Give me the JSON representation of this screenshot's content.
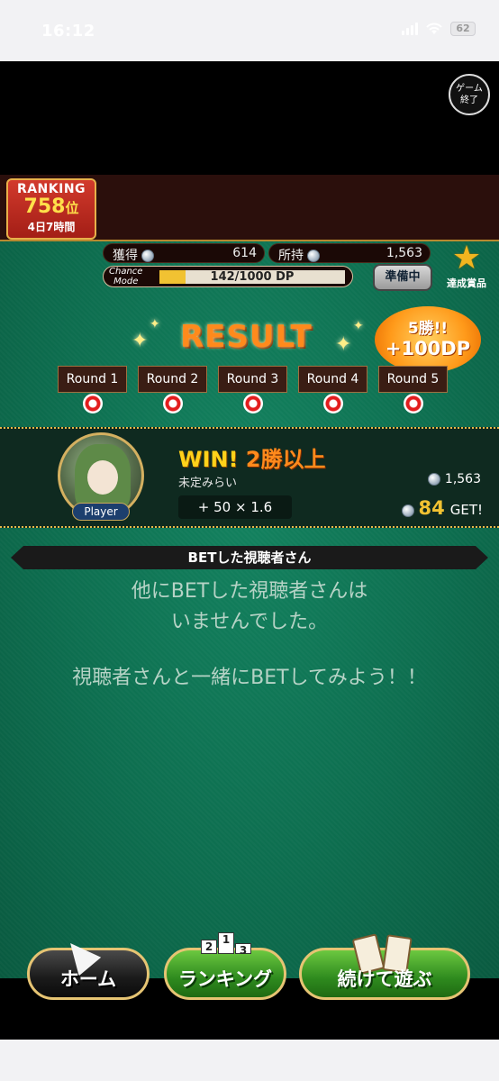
{
  "status_bar": {
    "time": "16:12",
    "battery": "62"
  },
  "game": {
    "exit_button": {
      "line1": "ゲーム",
      "line2": "終了"
    },
    "ranking": {
      "title": "RANKING",
      "position": "758",
      "position_unit": "位",
      "time_left": "4日7時間"
    },
    "stats": {
      "earned_label": "獲得",
      "earned_value": "614",
      "owned_label": "所持",
      "owned_value": "1,563"
    },
    "chance_mode": {
      "label_line1": "Chance",
      "label_line2": "Mode",
      "progress_text": "142/1000 DP",
      "progress_fraction": 0.142
    },
    "prep_button": "準備中",
    "achievement_button": "達成賞品",
    "result": {
      "title": "RESULT",
      "bonus_line1": "5勝!!",
      "bonus_line2": "+100DP",
      "rounds": [
        "Round 1",
        "Round 2",
        "Round 3",
        "Round 4",
        "Round 5"
      ]
    },
    "player": {
      "tag": "Player",
      "win_word": "WIN!",
      "win_condition": "2勝以上",
      "name": "未定みらい",
      "coins": "1,563",
      "calc": "+ 50 × 1.6",
      "get_amount": "84",
      "get_label": "GET!"
    },
    "viewers": {
      "header": "BETした視聴者さん",
      "message_line1": "他にBETした視聴者さんは",
      "message_line2": "いませんでした。",
      "message_line3": "視聴者さんと一緒にBETしてみよう！！"
    },
    "buttons": {
      "home": "ホーム",
      "ranking": "ランキング",
      "continue": "続けて遊ぶ"
    }
  },
  "colors": {
    "felt": "#0d6e4f",
    "accent_orange": "#ff8a1c",
    "gold": "#e8b94a",
    "red_rank": "#d23a2c"
  }
}
